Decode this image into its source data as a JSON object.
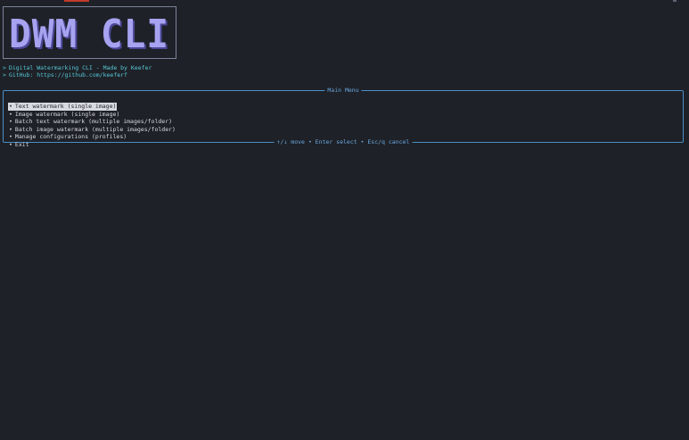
{
  "banner": {
    "logo_text": "DWM CLI",
    "logo_color": "#a7a3f0",
    "logo_shadow_color": "#4b4796"
  },
  "info": {
    "chevron": ">",
    "line1": "Digital Watermarking CLI - Made by Keefer",
    "line2": "GitHub: https://github.com/keeferf"
  },
  "menu": {
    "title": "Main Menu",
    "bullet": "•",
    "items": [
      {
        "label": "Text watermark (single image)",
        "selected": true
      },
      {
        "label": "Image watermark (single image)",
        "selected": false
      },
      {
        "label": "Batch text watermark (multiple images/folder)",
        "selected": false
      },
      {
        "label": "Batch image watermark (multiple images/folder)",
        "selected": false
      },
      {
        "label": "Manage configurations (profiles)",
        "selected": false
      },
      {
        "label": "Exit",
        "selected": false
      }
    ],
    "footer_hint": "↑/↓  move • Enter  select • Esc/q  cancel"
  },
  "colors": {
    "background": "#1e2127",
    "accent": "#4a8fc9",
    "info_text": "#56c8d8"
  }
}
